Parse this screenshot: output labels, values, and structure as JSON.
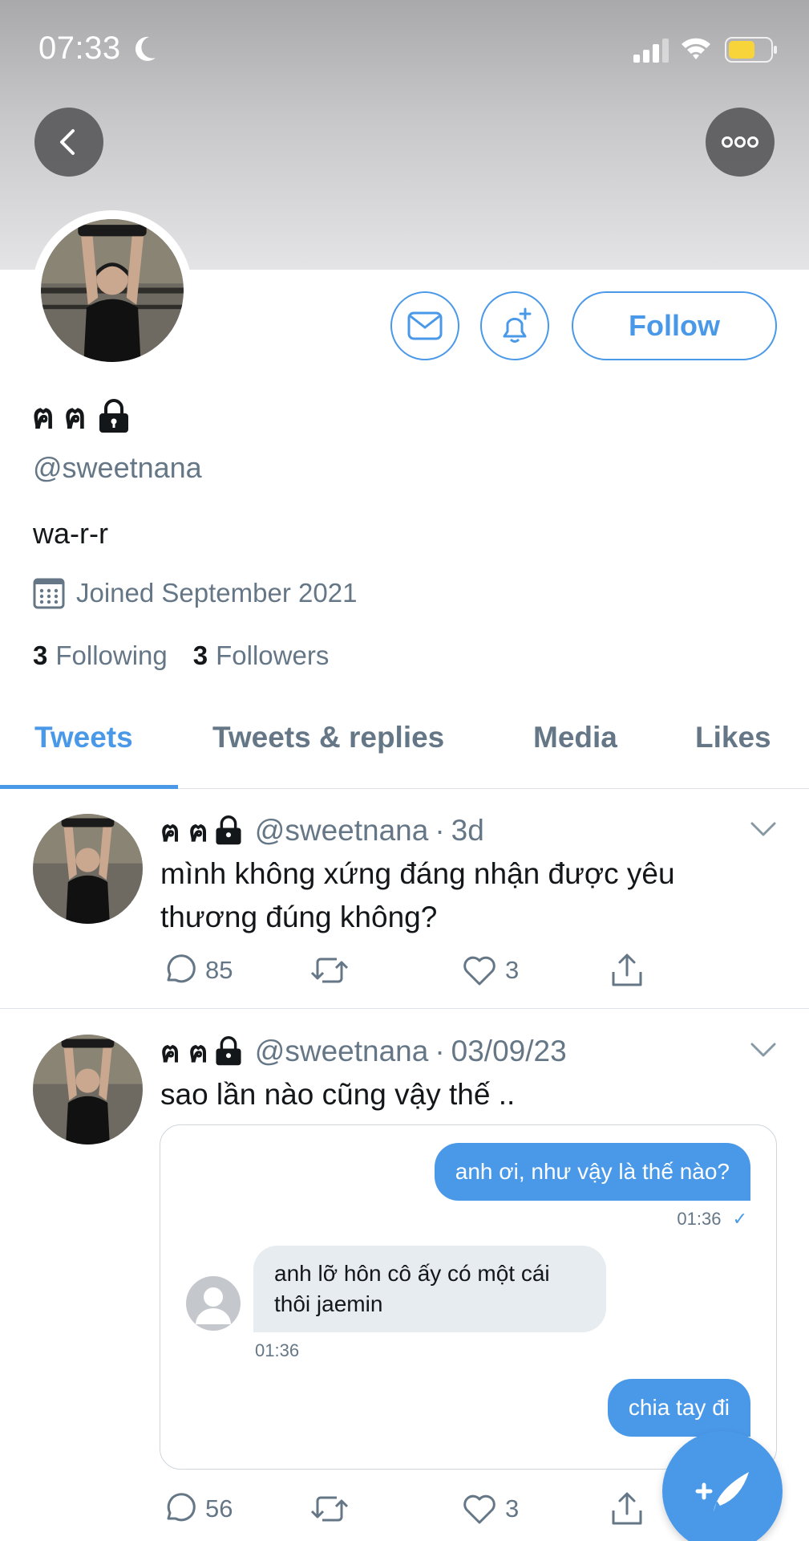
{
  "status_bar": {
    "time": "07:33"
  },
  "profile": {
    "display_name": "ฅ ฅ",
    "handle": "@sweetnana",
    "bio": "wa-r-r",
    "joined": "Joined September 2021",
    "following_count": "3",
    "following_label": "Following",
    "followers_count": "3",
    "followers_label": "Followers",
    "follow_label": "Follow"
  },
  "tabs": [
    {
      "label": "Tweets",
      "active": true
    },
    {
      "label": "Tweets & replies",
      "active": false
    },
    {
      "label": "Media",
      "active": false
    },
    {
      "label": "Likes",
      "active": false
    }
  ],
  "tweets": [
    {
      "name": "ฅ ฅ",
      "handle": "@sweetnana",
      "sep": "·",
      "time": "3d",
      "text": "mình không xứng đáng nhận được yêu thương đúng không?",
      "replies": "85",
      "retweets": "",
      "likes": "3"
    },
    {
      "name": "ฅ ฅ",
      "handle": "@sweetnana",
      "sep": "·",
      "time": "03/09/23",
      "text": "sao lần nào cũng vậy thế ..",
      "replies": "56",
      "retweets": "",
      "likes": "3",
      "chat": {
        "msg1": "anh ơi, như vậy là thế nào?",
        "msg1_time": "01:36",
        "msg1_check": "✓",
        "msg2": "anh lỡ hôn cô ấy có một cái thôi jaemin",
        "msg2_time": "01:36",
        "msg3": "chia tay đi"
      }
    }
  ],
  "colors": {
    "accent": "#4a99e9",
    "secondary_text": "#657786",
    "battery": "#f7d43a"
  },
  "icons": [
    "moon-icon",
    "signal-icon",
    "wifi-icon",
    "battery-icon",
    "back-icon",
    "more-icon",
    "mail-icon",
    "bell-plus-icon",
    "lock-icon",
    "calendar-icon",
    "chevron-down-icon",
    "reply-icon",
    "retweet-icon",
    "like-icon",
    "share-icon",
    "compose-icon"
  ]
}
